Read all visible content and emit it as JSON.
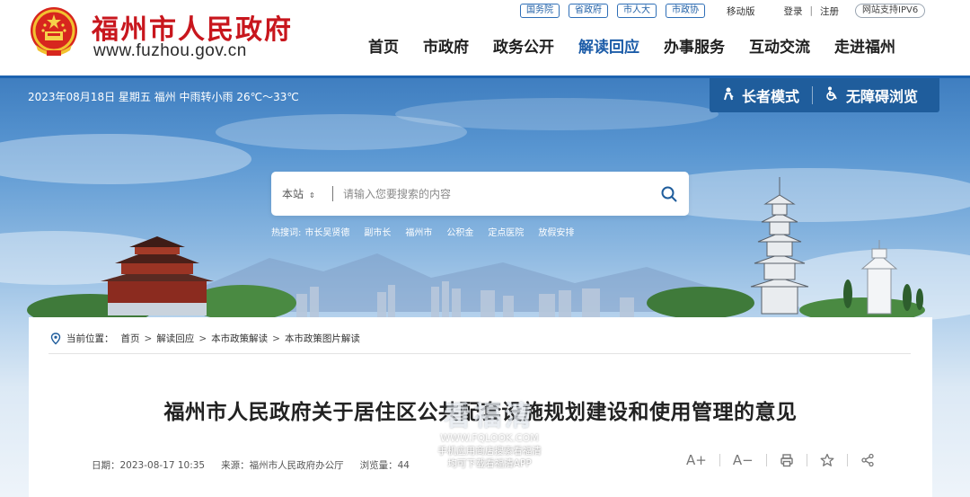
{
  "header": {
    "site_name": "福州市人民政府",
    "site_url": "www.fuzhou.gov.cn",
    "top_links": {
      "gov_pills": [
        "国务院",
        "省政府",
        "市人大",
        "市政协"
      ],
      "mobile": "移动版",
      "login": "登录",
      "separator": "|",
      "register": "注册",
      "ipv6": "网站支持IPV6"
    },
    "nav": [
      {
        "label": "首页"
      },
      {
        "label": "市政府"
      },
      {
        "label": "政务公开"
      },
      {
        "label": "解读回应",
        "active": true
      },
      {
        "label": "办事服务"
      },
      {
        "label": "互动交流"
      },
      {
        "label": "走进福州"
      }
    ]
  },
  "banner": {
    "weather": "2023年08月18日 星期五  福州 中雨转小雨 26℃～33℃",
    "access": {
      "elder_mode": "长者模式",
      "barrier_free": "无障碍浏览"
    },
    "search": {
      "scope": "本站",
      "placeholder": "请输入您要搜索的内容"
    },
    "hot": {
      "label": "热搜词:",
      "words": [
        "市长吴贤德",
        "副市长",
        "福州市",
        "公积金",
        "定点医院",
        "放假安排"
      ]
    }
  },
  "breadcrumb": {
    "label": "当前位置：",
    "items": [
      "首页",
      "解读回应",
      "本市政策解读",
      "本市政策图片解读"
    ],
    "separator": ">"
  },
  "article": {
    "title": "福州市人民政府关于居住区公共配套设施规划建设和使用管理的意见",
    "date": "日期：2023-08-17 10:35",
    "source": "来源：福州市人民政府办公厅",
    "views": "浏览量：44",
    "tools": {
      "font_larger": "A+",
      "font_smaller": "A−"
    }
  },
  "watermark": {
    "brand": "看福清",
    "url": "WWW.FQLOOK.COM",
    "tip1": "手机应用商店搜索看福清",
    "tip2": "均可下载看福清APP"
  },
  "colors": {
    "brand_red": "#c8161d",
    "nav_blue": "#1c5ca8",
    "header_line": "#1e63b0",
    "access_bg": "#1f5d9c"
  }
}
